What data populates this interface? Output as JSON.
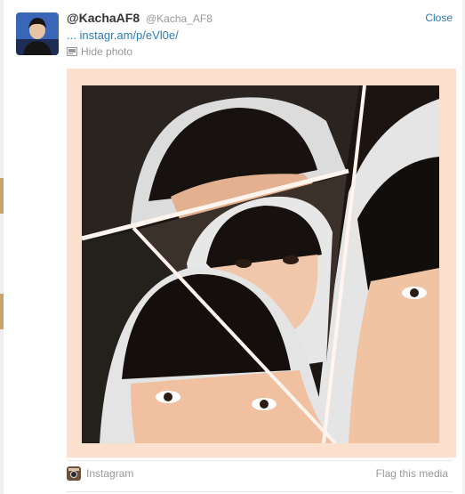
{
  "tweet": {
    "display_name": "@KachaAF8",
    "handle": "@Kacha_AF8",
    "link_prefix": "...",
    "link_text": "instagr.am/p/eVl0e/",
    "hide_photo_label": "Hide photo",
    "close_label": "Close"
  },
  "media": {
    "source_label": "Instagram",
    "flag_label": "Flag this media"
  },
  "colors": {
    "link": "#2b7bb9",
    "frame": "#fbe1cd",
    "muted": "#999999"
  },
  "icons": {
    "hide_photo": "photo-icon",
    "source": "instagram-icon"
  }
}
